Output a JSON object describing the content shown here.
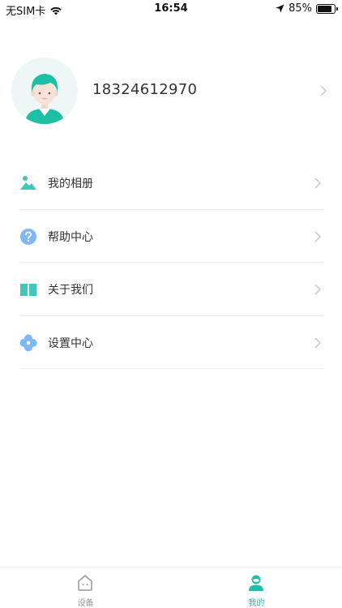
{
  "status_bar": {
    "carrier": "无SIM卡",
    "time": "16:54",
    "battery_percent": "85%",
    "battery_level": 0.85,
    "icons": [
      "wifi-icon",
      "location-arrow-icon",
      "battery-icon"
    ]
  },
  "profile": {
    "phone": "18324612970",
    "avatar_icon": "user-avatar-icon"
  },
  "menu": {
    "items": [
      {
        "label": "我的相册",
        "icon": "album-icon",
        "color": "#3fc8b5"
      },
      {
        "label": "帮助中心",
        "icon": "help-icon",
        "color": "#7eb8f7"
      },
      {
        "label": "关于我们",
        "icon": "book-icon",
        "color": "#3fc8b5"
      },
      {
        "label": "设置中心",
        "icon": "settings-flower-icon",
        "color": "#7eb8f7"
      }
    ]
  },
  "tab_bar": {
    "tabs": [
      {
        "label": "设备",
        "icon": "device-home-icon",
        "active": false
      },
      {
        "label": "我的",
        "icon": "profile-icon",
        "active": true
      }
    ]
  },
  "colors": {
    "accent": "#1fbfa6",
    "inactive": "#999999",
    "divider": "#eeeeee"
  }
}
